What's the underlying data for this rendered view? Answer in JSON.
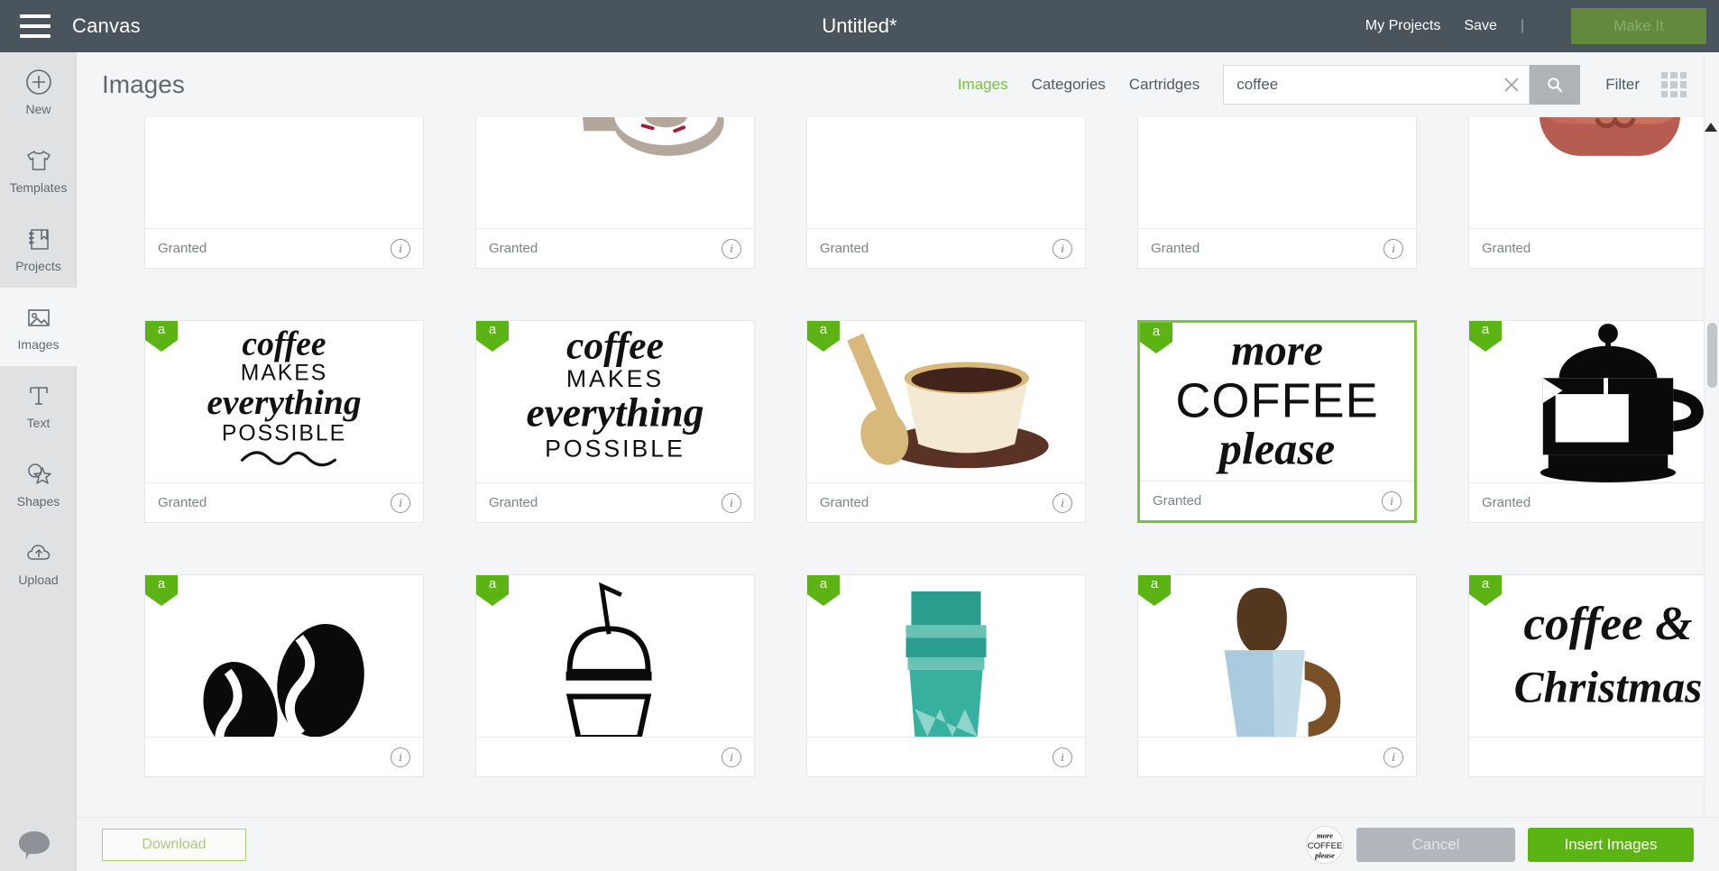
{
  "topbar": {
    "menu_icon": "hamburger-icon",
    "canvas_label": "Canvas",
    "document_title": "Untitled*",
    "my_projects_label": "My Projects",
    "save_label": "Save",
    "separator": "|",
    "make_it_label": "Make It",
    "bar_color": "#4a545c",
    "make_it_color": "#63893d"
  },
  "sidebar": {
    "items": [
      {
        "label": "New",
        "icon": "plus-circle-icon",
        "active": false
      },
      {
        "label": "Templates",
        "icon": "tshirt-icon",
        "active": false
      },
      {
        "label": "Projects",
        "icon": "book-bookmark-icon",
        "active": false
      },
      {
        "label": "Images",
        "icon": "picture-icon",
        "active": true
      },
      {
        "label": "Text",
        "icon": "text-t-icon",
        "active": false
      },
      {
        "label": "Shapes",
        "icon": "star-shape-icon",
        "active": false
      },
      {
        "label": "Upload",
        "icon": "cloud-upload-icon",
        "active": false
      }
    ]
  },
  "panel": {
    "title": "Images",
    "tabs": [
      {
        "label": "Images",
        "active": true
      },
      {
        "label": "Categories",
        "active": false
      },
      {
        "label": "Cartridges",
        "active": false
      }
    ],
    "search": {
      "value": "coffee",
      "placeholder": "Search",
      "clear_icon": "close-x-icon",
      "search_icon": "magnifier-icon"
    },
    "filter_label": "Filter",
    "grid_toggle_icon": "grid-view-icon",
    "active_tab_color": "#7ac143"
  },
  "cards": [
    {
      "id": "fresh-text",
      "badge": "",
      "status": "Granted",
      "selected": false,
      "art": "fresh",
      "clipped_top": true
    },
    {
      "id": "cup-and-donut",
      "badge": "",
      "status": "Granted",
      "selected": false,
      "art": "donut",
      "clipped_top": true
    },
    {
      "id": "coffee-word-dark",
      "badge": "",
      "status": "Granted",
      "selected": false,
      "art": "coffeeword1",
      "clipped_top": true
    },
    {
      "id": "coffee-word-red",
      "badge": "",
      "status": "Granted",
      "selected": false,
      "art": "coffeeword2",
      "clipped_top": true
    },
    {
      "id": "kawaii-bean-face",
      "badge": "",
      "status": "Granted",
      "selected": false,
      "art": "kawaii",
      "clipped_top": false
    },
    {
      "id": "coffee-makes-everything-possible-1",
      "badge": "a",
      "status": "Granted",
      "selected": false,
      "art": "quote1",
      "clipped_top": false
    },
    {
      "id": "coffee-makes-everything-possible-2",
      "badge": "a",
      "status": "Granted",
      "selected": false,
      "art": "quote2",
      "clipped_top": false
    },
    {
      "id": "coffee-cup-with-spoon",
      "badge": "a",
      "status": "Granted",
      "selected": false,
      "art": "cupspoon",
      "clipped_top": false
    },
    {
      "id": "more-coffee-please",
      "badge": "a",
      "status": "Granted",
      "selected": true,
      "art": "morecoffee",
      "clipped_top": false
    },
    {
      "id": "french-press-black",
      "badge": "a",
      "status": "Granted",
      "selected": false,
      "art": "frenchpress",
      "clipped_top": false
    },
    {
      "id": "coffee-beans",
      "badge": "a",
      "status": "",
      "selected": false,
      "art": "beans",
      "clipped_top": false
    },
    {
      "id": "iced-drink-outline",
      "badge": "a",
      "status": "",
      "selected": false,
      "art": "iced",
      "clipped_top": false
    },
    {
      "id": "teal-togo-cup",
      "badge": "a",
      "status": "",
      "selected": false,
      "art": "tealcup",
      "clipped_top": false
    },
    {
      "id": "blue-coffee-pot",
      "badge": "a",
      "status": "",
      "selected": false,
      "art": "bluepot",
      "clipped_top": false
    },
    {
      "id": "coffee-and-script",
      "badge": "a",
      "status": "",
      "selected": false,
      "art": "coffeeand",
      "clipped_top": false
    }
  ],
  "footer": {
    "download_label": "Download",
    "cancel_label": "Cancel",
    "insert_label": "Insert Images",
    "selected_thumb_alt": "more coffee please",
    "insert_color": "#5cb314",
    "cancel_color": "#b3b7bb",
    "download_border_color": "#a9d26b"
  },
  "chat": {
    "icon": "chat-bubble-icon"
  },
  "scrollbar": {
    "thumb_position": "300"
  }
}
